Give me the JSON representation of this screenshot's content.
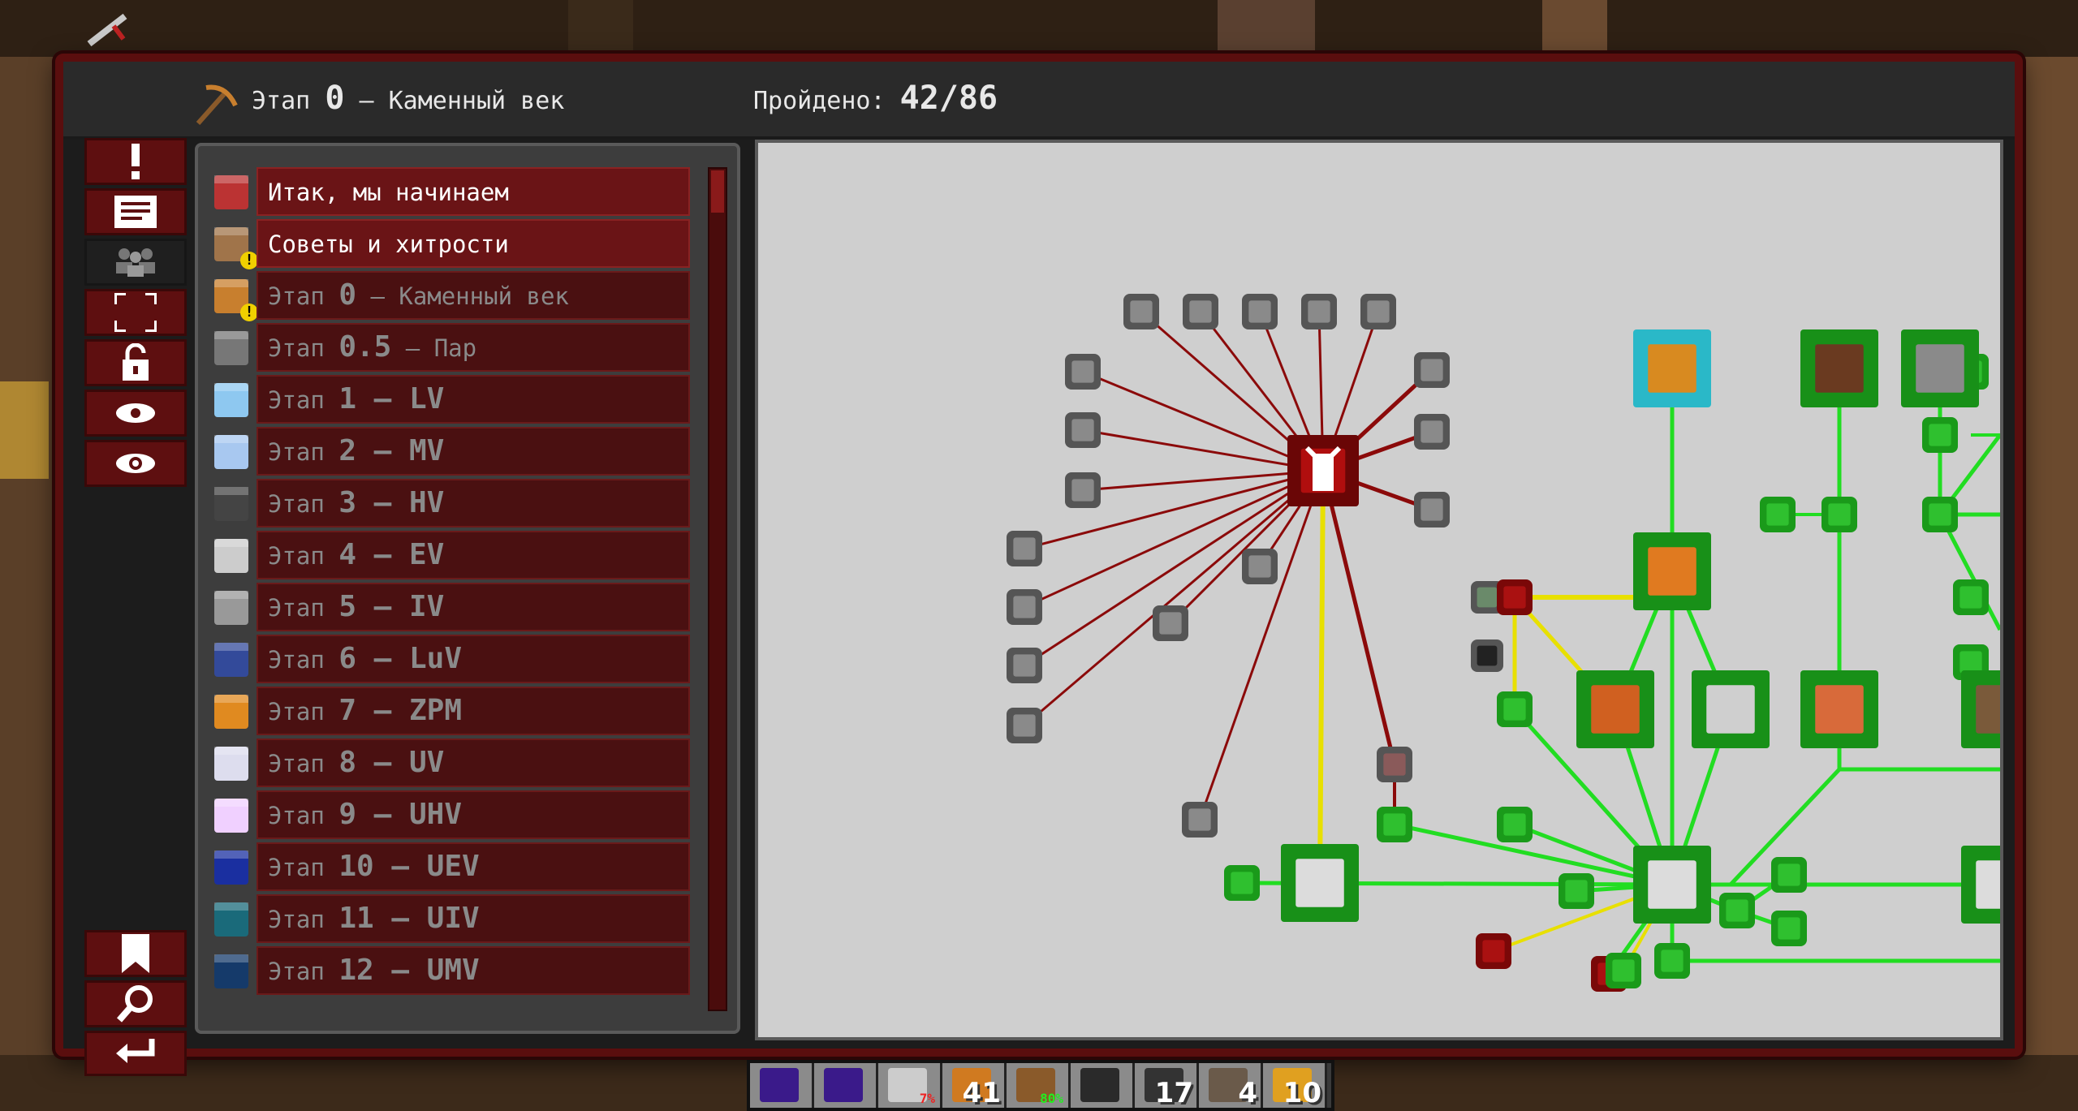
{
  "header": {
    "stage_prefix": "Этап",
    "stage_number": "0",
    "stage_suffix": "– Каменный век",
    "progress_label": "Пройдено:",
    "progress_value": "42/86"
  },
  "toolbar": {
    "top_icons": [
      "exclamation-icon",
      "text-lines-icon",
      "people-icon",
      "fullscreen-icon",
      "lock-icon",
      "eye-icon",
      "eye-alt-icon"
    ],
    "bottom_icons": [
      "bookmark-icon",
      "magnifier-icon",
      "back-arrow-icon"
    ]
  },
  "chapters": [
    {
      "prefix": "Итак, мы начинаем",
      "num": "",
      "suffix": "",
      "icon": "bed-icon",
      "active": true,
      "warn": false
    },
    {
      "prefix": "Советы и хитрости",
      "num": "",
      "suffix": "",
      "icon": "book-icon",
      "active": true,
      "warn": true
    },
    {
      "prefix": "Этап ",
      "num": "0",
      "suffix": " – Каменный век",
      "icon": "pickaxe-icon",
      "active": false,
      "warn": true
    },
    {
      "prefix": "Этап ",
      "num": "0.5",
      "suffix": " – Пар",
      "icon": "wrench-icon",
      "active": false,
      "warn": false
    },
    {
      "prefix": "Этап ",
      "num": "1 – LV",
      "suffix": "",
      "icon": "blue-plate-icon",
      "active": false,
      "warn": false
    },
    {
      "prefix": "Этап ",
      "num": "2 – MV",
      "suffix": "",
      "icon": "blue-ingot-icon",
      "active": false,
      "warn": false
    },
    {
      "prefix": "Этап ",
      "num": "3 – HV",
      "suffix": "",
      "icon": "dark-ore-icon",
      "active": false,
      "warn": false
    },
    {
      "prefix": "Этап ",
      "num": "4 – EV",
      "suffix": "",
      "icon": "radiation-block-icon",
      "active": false,
      "warn": false
    },
    {
      "prefix": "Этап ",
      "num": "5 – IV",
      "suffix": "",
      "icon": "machine-casing-icon",
      "active": false,
      "warn": false
    },
    {
      "prefix": "Этап ",
      "num": "6 – LuV",
      "suffix": "",
      "icon": "luv-casing-icon",
      "active": false,
      "warn": false
    },
    {
      "prefix": "Этап ",
      "num": "7 – ZPM",
      "suffix": "",
      "icon": "zpm-rod-icon",
      "active": false,
      "warn": false
    },
    {
      "prefix": "Этап ",
      "num": "8 – UV",
      "suffix": "",
      "icon": "uv-casing-icon",
      "active": false,
      "warn": false
    },
    {
      "prefix": "Этап ",
      "num": "9 – UHV",
      "suffix": "",
      "icon": "rainbow-ingot-icon",
      "active": false,
      "warn": false
    },
    {
      "prefix": "Этап ",
      "num": "10 – UEV",
      "suffix": "",
      "icon": "uev-block-icon",
      "active": false,
      "warn": false
    },
    {
      "prefix": "Этап ",
      "num": "11 – UIV",
      "suffix": "",
      "icon": "uiv-block-icon",
      "active": false,
      "warn": false
    },
    {
      "prefix": "Этап ",
      "num": "12 – UMV",
      "suffix": "",
      "icon": "umv-block-icon",
      "active": false,
      "warn": false
    }
  ],
  "quest_map": {
    "hub_icon": "wrench-icon",
    "root_quest_icon": "iron-ingot-icon",
    "main_quest_icon": "pickaxe-icon",
    "locked_color": "#8b0a0a",
    "available_color": "#e8e000",
    "complete_color": "#22dd22",
    "highlight_color": "#2ab8c8"
  },
  "hotbar": {
    "slots": [
      {
        "icon": "purple-backpack-icon",
        "count": ""
      },
      {
        "icon": "purple-backpack-icon",
        "count": ""
      },
      {
        "icon": "gauge-icon",
        "count": "",
        "pct": "7%"
      },
      {
        "icon": "copper-ingot-icon",
        "count": "41"
      },
      {
        "icon": "pickaxe-icon",
        "count": "",
        "pct": "80%"
      },
      {
        "icon": "empty-slot",
        "count": ""
      },
      {
        "icon": "coal-block-icon",
        "count": "17"
      },
      {
        "icon": "gravel-icon",
        "count": "4"
      },
      {
        "icon": "flower-icon",
        "count": "10"
      }
    ]
  }
}
